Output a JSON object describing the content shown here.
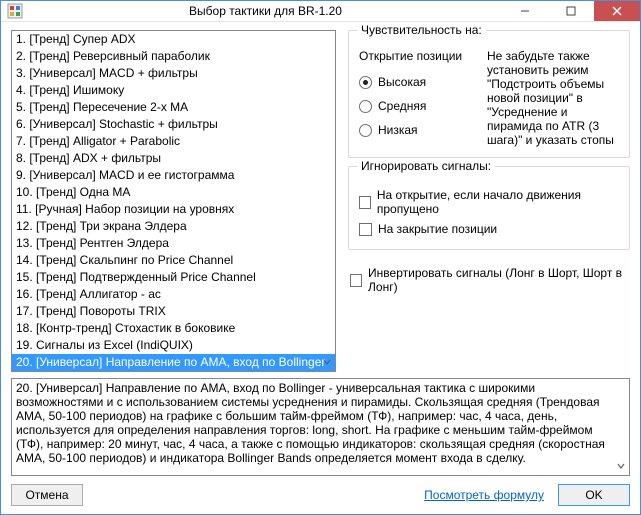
{
  "window": {
    "title": "Выбор тактики для BR-1.20"
  },
  "tactics": {
    "items": [
      "1. [Тренд] Супер ADX",
      "2. [Тренд] Реверсивный параболик",
      "3. [Универсал] MACD + фильтры",
      "4. [Тренд] Ишимоку",
      "5. [Тренд] Пересечение 2-х MA",
      "6. [Универсал] Stochastic + фильтры",
      "7. [Тренд] Alligator + Parabolic",
      "8. [Тренд] ADX + фильтры",
      "9. [Универсал] MACD и ее гистограмма",
      "10. [Тренд] Одна MA",
      "11. [Ручная] Набор позиции на уровнях",
      "12. [Тренд] Три экрана Элдера",
      "13. [Тренд] Рентген Элдера",
      "14. [Тренд] Скальпинг по Price Channel",
      "15. [Тренд] Подтвержденный Price Channel",
      "16. [Тренд] Аллигатор - ас",
      "17. [Тренд] Повороты TRIX",
      "18. [Контр-тренд] Стохастик в боковике",
      "19. Сигналы из Excel (IndiQUIX)",
      "20. [Универсал] Направление по AMA, вход по Bollinger"
    ],
    "selected_index": 19
  },
  "sensitivity": {
    "group_title": "Чувствительность на:",
    "open_label": "Открытие позиции",
    "radios": {
      "high": "Высокая",
      "medium": "Средняя",
      "low": "Низкая"
    },
    "selected": "high",
    "note": "Не забудьте также установить режим \"Подстроить объемы новой позиции\" в \"Усреднение и пирамида по ATR (3 шага)\" и указать стопы"
  },
  "ignore": {
    "group_title": "Игнорировать сигналы:",
    "open_skip": "На открытие, если начало движения пропущено",
    "close": "На закрытие позиции"
  },
  "invert": {
    "label": "Инвертировать сигналы (Лонг в Шорт, Шорт в Лонг)"
  },
  "description": {
    "text": "20. [Универсал] Направление по AMA, вход по Bollinger - универсальная тактика с широкими возможностями и с использованием системы усреднения и пирамиды. Скользящая средняя (Трендовая AMA, 50-100 периодов) на графике с большим тайм-фреймом (ТФ), например: час, 4 часа, день, используется для определения направления торгов: long, short. На графике с меньшим тайм-фреймом (ТФ), например: 20 минут, час, 4 часа, а также с помощью индикаторов: скользящая средняя (скоростная AMA, 50-100 периодов) и индикатора Bollinger Bands определяется момент входа в сделку.\n\nПри высокой чувствительности торговый алгоритм настроен на высокую волатильность, т.е. широкий диапазон"
  },
  "footer": {
    "cancel": "Отмена",
    "formula_link": "Посмотреть формулу",
    "ok": "OK"
  }
}
